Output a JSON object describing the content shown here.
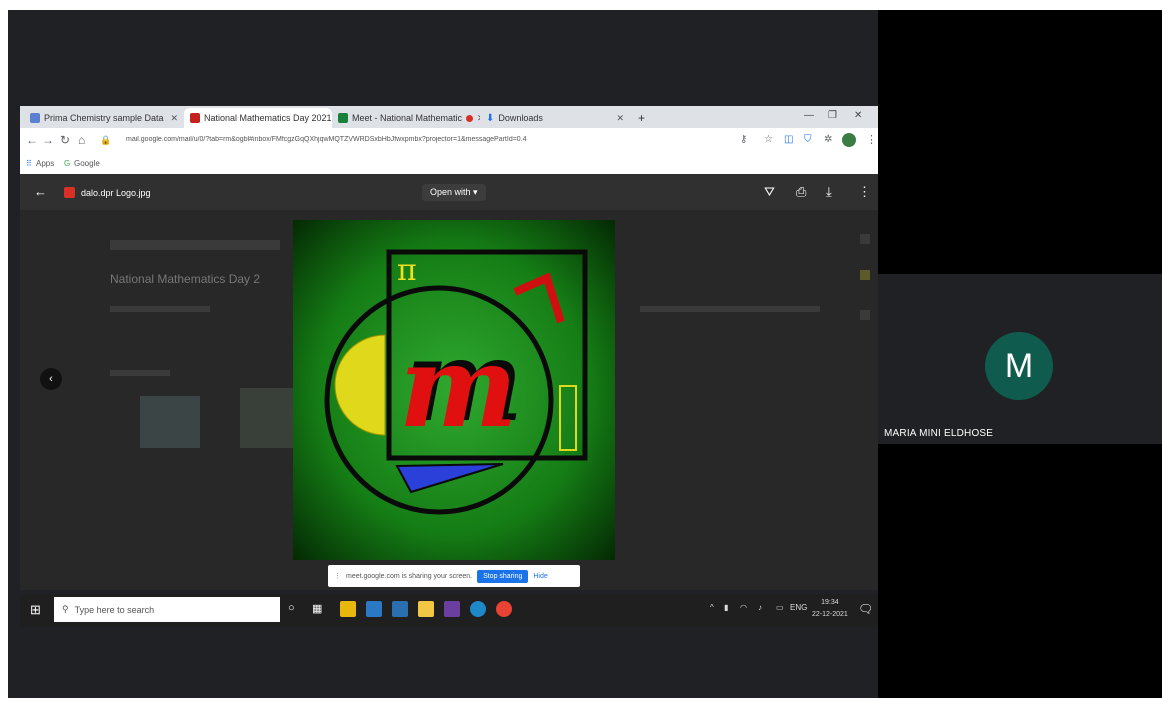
{
  "participant": {
    "initial": "M",
    "name": "MARIA MINI ELDHOSE"
  },
  "browser": {
    "tabs": [
      {
        "label": "Prima Chemistry sample Data"
      },
      {
        "label": "National Mathematics Day 2021"
      },
      {
        "label": "Meet - National Mathematic"
      },
      {
        "label": "Downloads"
      }
    ],
    "url": "mail.google.com/mail/u/0/?tab=rm&ogbl#inbox/FMfcgzGqQXhjqwMQTZVWRDSxbHbJfwxpmbx?projector=1&messagePartId=0.4",
    "bookmarks": {
      "apps": "Apps",
      "google": "Google"
    }
  },
  "viewer": {
    "file_name": "dalo.dpr Logo.jpg",
    "open_with": "Open with ▾",
    "doc_title": "National Mathematics Day 2"
  },
  "logo": {
    "pi": "π",
    "m": "m"
  },
  "sharing": {
    "message": "meet.google.com is sharing your screen.",
    "stop": "Stop sharing",
    "hide": "Hide"
  },
  "taskbar": {
    "search_placeholder": "Type here to search",
    "lang": "ENG",
    "time": "19:34",
    "date": "22-12-2021"
  }
}
